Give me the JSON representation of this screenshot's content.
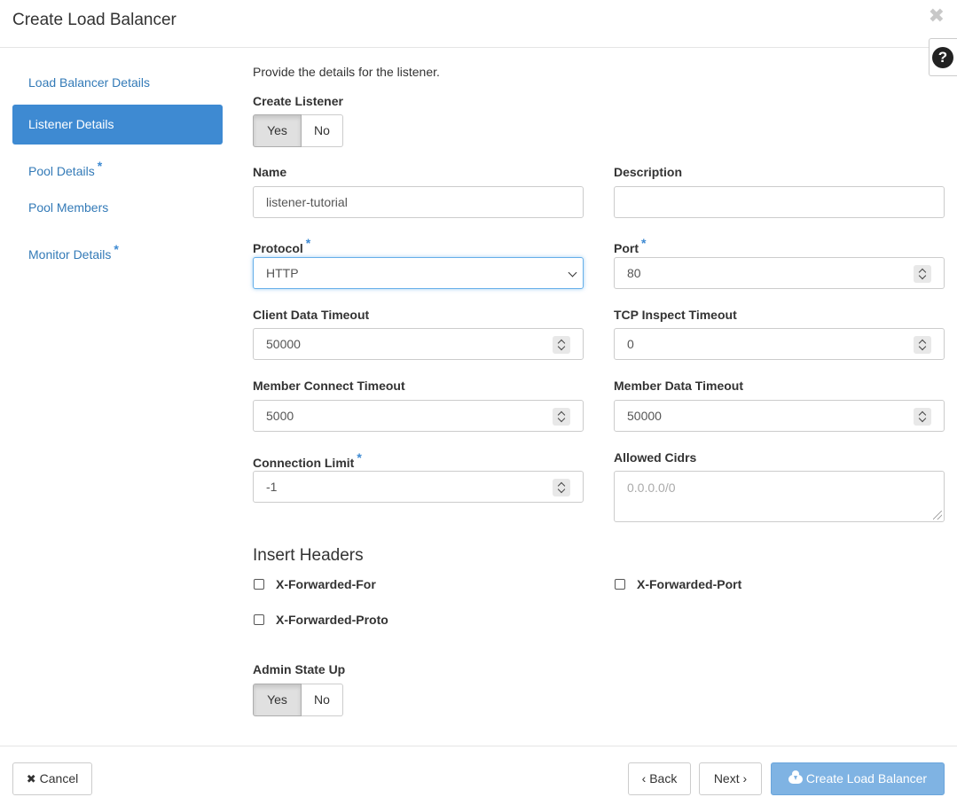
{
  "header": {
    "title": "Create Load Balancer",
    "close_glyph": "✖",
    "help_glyph": "?"
  },
  "sidebar": {
    "items": [
      {
        "label": "Load Balancer Details",
        "required": false,
        "active": false
      },
      {
        "label": "Listener Details",
        "required": false,
        "active": true
      },
      {
        "label": "Pool Details",
        "required": true,
        "active": false
      },
      {
        "label": "Pool Members",
        "required": false,
        "active": false
      },
      {
        "label": "Monitor Details",
        "required": true,
        "active": false
      }
    ],
    "required_marker": "*"
  },
  "form": {
    "intro": "Provide the details for the listener.",
    "create_listener": {
      "label": "Create Listener",
      "yes": "Yes",
      "no": "No",
      "selected": "Yes"
    },
    "name": {
      "label": "Name",
      "value": "listener-tutorial"
    },
    "description": {
      "label": "Description",
      "value": ""
    },
    "protocol": {
      "label": "Protocol",
      "value": "HTTP"
    },
    "port": {
      "label": "Port",
      "value": "80"
    },
    "client_data_timeout": {
      "label": "Client Data Timeout",
      "value": "50000"
    },
    "tcp_inspect_timeout": {
      "label": "TCP Inspect Timeout",
      "value": "0"
    },
    "member_connect_timeout": {
      "label": "Member Connect Timeout",
      "value": "5000"
    },
    "member_data_timeout": {
      "label": "Member Data Timeout",
      "value": "50000"
    },
    "connection_limit": {
      "label": "Connection Limit",
      "value": "-1"
    },
    "allowed_cidrs": {
      "label": "Allowed Cidrs",
      "placeholder": "0.0.0.0/0"
    },
    "insert_headers": {
      "title": "Insert Headers",
      "x_forwarded_for": "X-Forwarded-For",
      "x_forwarded_port": "X-Forwarded-Port",
      "x_forwarded_proto": "X-Forwarded-Proto"
    },
    "admin_state_up": {
      "label": "Admin State Up",
      "yes": "Yes",
      "no": "No",
      "selected": "Yes"
    },
    "required_marker": "*"
  },
  "footer": {
    "cancel": "Cancel",
    "back": "Back",
    "next": "Next",
    "create": "Create Load Balancer",
    "cancel_glyph": "✖",
    "back_glyph": "‹",
    "next_glyph": "›"
  },
  "colors": {
    "accent": "#3e8ad2",
    "link": "#337ab7",
    "primary_disabled": "#7fb3e3"
  }
}
